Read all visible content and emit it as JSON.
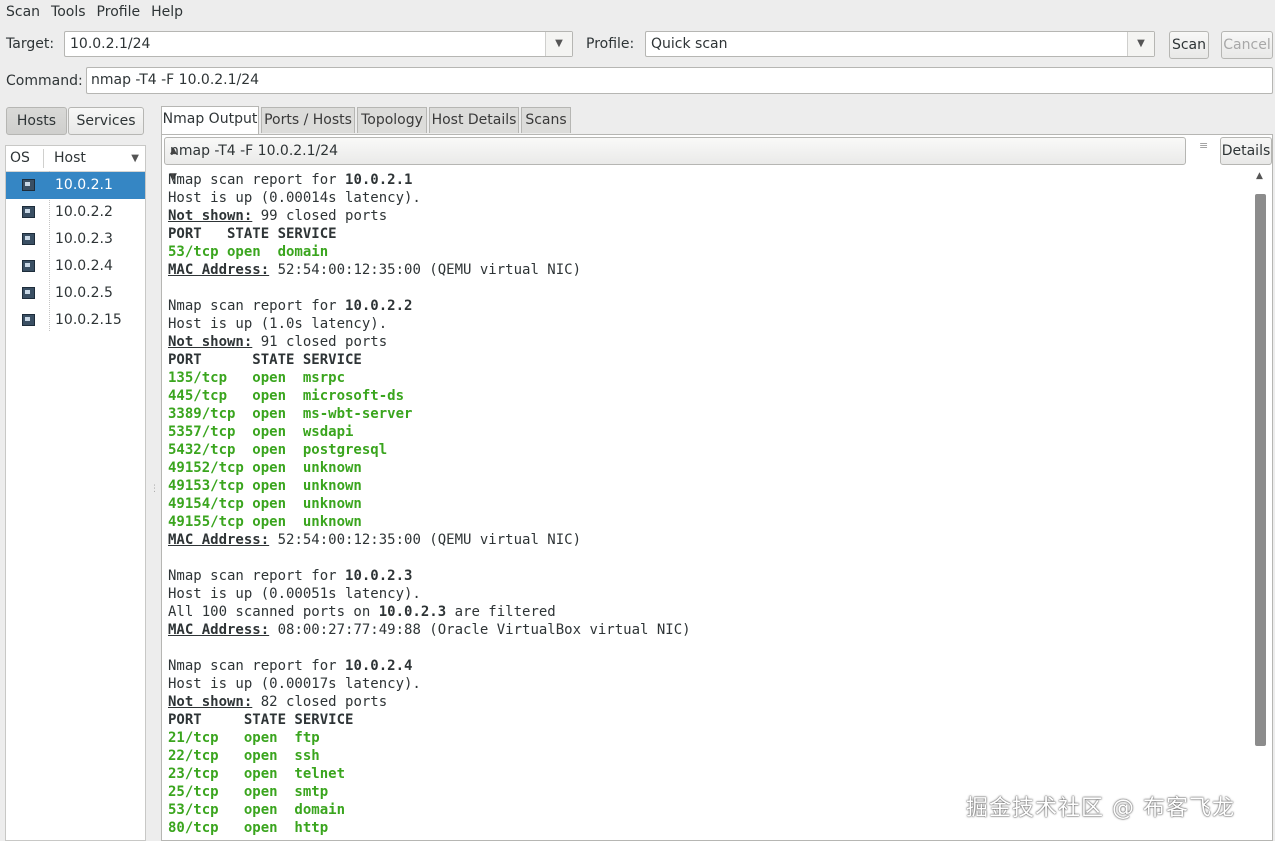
{
  "menu": [
    "Scan",
    "Tools",
    "Profile",
    "Help"
  ],
  "toolbar": {
    "target_label": "Target:",
    "target_value": "10.0.2.1/24",
    "profile_label": "Profile:",
    "profile_value": "Quick scan",
    "scan_label": "Scan",
    "cancel_label": "Cancel",
    "command_label": "Command:",
    "command_value": "nmap -T4 -F 10.0.2.1/24"
  },
  "left": {
    "hosts_btn": "Hosts",
    "services_btn": "Services",
    "col_os": "OS",
    "col_host": "Host",
    "hosts": [
      "10.0.2.1",
      "10.0.2.2",
      "10.0.2.3",
      "10.0.2.4",
      "10.0.2.5",
      "10.0.2.15"
    ],
    "selected": "10.0.2.1"
  },
  "tabs": [
    "Nmap Output",
    "Ports / Hosts",
    "Topology",
    "Host Details",
    "Scans"
  ],
  "output_select": "nmap -T4 -F 10.0.2.1/24",
  "details_btn": "Details",
  "output_lines": [
    [
      [
        "t",
        "Nmap scan report for "
      ],
      [
        "b",
        "10.0.2.1"
      ]
    ],
    [
      [
        "t",
        "Host is up (0.00014s latency)."
      ]
    ],
    [
      [
        "u",
        "Not shown:"
      ],
      [
        "t",
        " 99 closed ports"
      ]
    ],
    [
      [
        "b",
        "PORT   STATE SERVICE"
      ]
    ],
    [
      [
        "g",
        "53/tcp open  domain"
      ]
    ],
    [
      [
        "u",
        "MAC Address:"
      ],
      [
        "t",
        " 52:54:00:12:35:00 (QEMU virtual NIC)"
      ]
    ],
    [],
    [
      [
        "t",
        "Nmap scan report for "
      ],
      [
        "b",
        "10.0.2.2"
      ]
    ],
    [
      [
        "t",
        "Host is up (1.0s latency)."
      ]
    ],
    [
      [
        "u",
        "Not shown:"
      ],
      [
        "t",
        " 91 closed ports"
      ]
    ],
    [
      [
        "b",
        "PORT      STATE SERVICE"
      ]
    ],
    [
      [
        "g",
        "135/tcp   open  msrpc"
      ]
    ],
    [
      [
        "g",
        "445/tcp   open  microsoft-ds"
      ]
    ],
    [
      [
        "g",
        "3389/tcp  open  ms-wbt-server"
      ]
    ],
    [
      [
        "g",
        "5357/tcp  open  wsdapi"
      ]
    ],
    [
      [
        "g",
        "5432/tcp  open  postgresql"
      ]
    ],
    [
      [
        "g",
        "49152/tcp open  unknown"
      ]
    ],
    [
      [
        "g",
        "49153/tcp open  unknown"
      ]
    ],
    [
      [
        "g",
        "49154/tcp open  unknown"
      ]
    ],
    [
      [
        "g",
        "49155/tcp open  unknown"
      ]
    ],
    [
      [
        "u",
        "MAC Address:"
      ],
      [
        "t",
        " 52:54:00:12:35:00 (QEMU virtual NIC)"
      ]
    ],
    [],
    [
      [
        "t",
        "Nmap scan report for "
      ],
      [
        "b",
        "10.0.2.3"
      ]
    ],
    [
      [
        "t",
        "Host is up (0.00051s latency)."
      ]
    ],
    [
      [
        "t",
        "All 100 scanned ports on "
      ],
      [
        "b",
        "10.0.2.3"
      ],
      [
        "t",
        " are filtered"
      ]
    ],
    [
      [
        "u",
        "MAC Address:"
      ],
      [
        "t",
        " 08:00:27:77:49:88 (Oracle VirtualBox virtual NIC)"
      ]
    ],
    [],
    [
      [
        "t",
        "Nmap scan report for "
      ],
      [
        "b",
        "10.0.2.4"
      ]
    ],
    [
      [
        "t",
        "Host is up (0.00017s latency)."
      ]
    ],
    [
      [
        "u",
        "Not shown:"
      ],
      [
        "t",
        " 82 closed ports"
      ]
    ],
    [
      [
        "b",
        "PORT     STATE SERVICE"
      ]
    ],
    [
      [
        "g",
        "21/tcp   open  ftp"
      ]
    ],
    [
      [
        "g",
        "22/tcp   open  ssh"
      ]
    ],
    [
      [
        "g",
        "23/tcp   open  telnet"
      ]
    ],
    [
      [
        "g",
        "25/tcp   open  smtp"
      ]
    ],
    [
      [
        "g",
        "53/tcp   open  domain"
      ]
    ],
    [
      [
        "g",
        "80/tcp   open  http"
      ]
    ]
  ],
  "watermark": "掘金技术社区 @ 布客飞龙",
  "colors": {
    "selection": "#3586c4",
    "open_port": "#3aa51e"
  }
}
